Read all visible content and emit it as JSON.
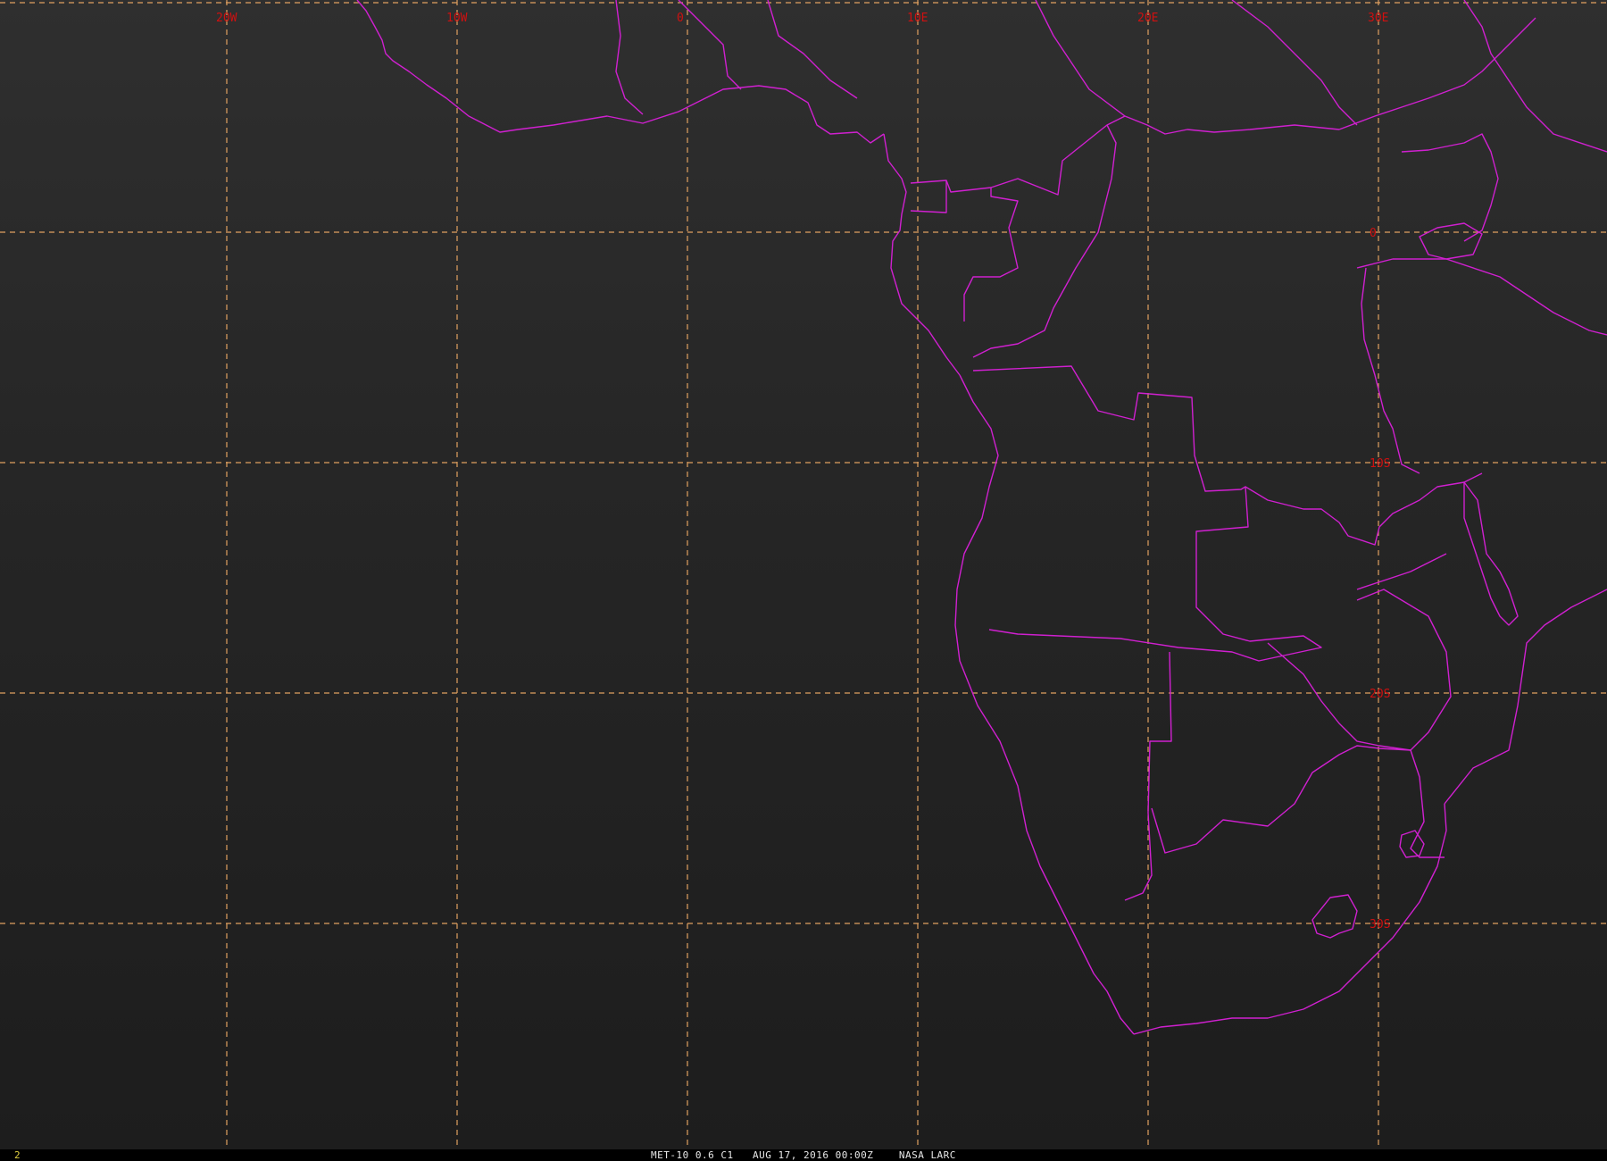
{
  "map": {
    "grid_color": "#e0a060",
    "border_color": "#d020d0",
    "label_color": "#d01010",
    "meridians": [
      {
        "lon": -20,
        "label": "20W"
      },
      {
        "lon": -10,
        "label": "10W"
      },
      {
        "lon": 0,
        "label": "0"
      },
      {
        "lon": 10,
        "label": "10E"
      },
      {
        "lon": 20,
        "label": "20E"
      },
      {
        "lon": 30,
        "label": "30E"
      }
    ],
    "parallels": [
      {
        "lat": 0,
        "label": "0"
      },
      {
        "lat": -10,
        "label": "10S"
      },
      {
        "lat": -20,
        "label": "20S"
      },
      {
        "lat": -30,
        "label": "30S"
      }
    ]
  },
  "status": {
    "frame_number": "2",
    "caption": "MET-10 0.6 C1   AUG 17, 2016 00:00Z    NASA LARC"
  }
}
